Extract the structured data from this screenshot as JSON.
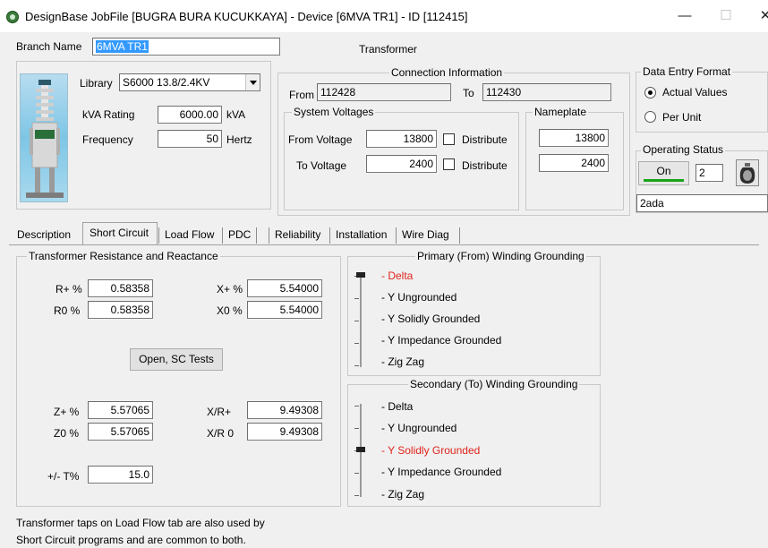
{
  "window": {
    "title": "DesignBase JobFile [BUGRA BURA KUCUKKAYA] - Device [6MVA TR1] - ID [112415]",
    "minimize_glyph": "—",
    "maximize_glyph": "☐",
    "close_glyph": "✕"
  },
  "header": {
    "branch_name_label": "Branch Name",
    "branch_name_value": "6MVA TR1",
    "device_type": "Transformer"
  },
  "library": {
    "label": "Library",
    "value": "S6000 13.8/2.4KV",
    "kva_label": "kVA Rating",
    "kva_value": "6000.00",
    "kva_unit": "kVA",
    "freq_label": "Frequency",
    "freq_value": "50",
    "freq_unit": "Hertz"
  },
  "connection": {
    "title": "Connection Information",
    "from_label": "From",
    "from_value": "112428",
    "to_label": "To",
    "to_value": "112430",
    "system_voltages_title": "System Voltages",
    "from_voltage_label": "From Voltage",
    "from_voltage_value": "13800",
    "to_voltage_label": "To Voltage",
    "to_voltage_value": "2400",
    "distribute_label": "Distribute",
    "nameplate_title": "Nameplate",
    "nameplate_from": "13800",
    "nameplate_to": "2400"
  },
  "data_entry": {
    "title": "Data Entry Format",
    "actual_values": "Actual Values",
    "per_unit": "Per Unit",
    "selected": "Actual Values"
  },
  "operating_status": {
    "title": "Operating Status",
    "on_label": "On",
    "count_value": "2",
    "note_value": "2ada"
  },
  "tabs": [
    "Description",
    "Short Circuit",
    "Load Flow",
    "PDC",
    "Reliability",
    "Installation",
    "Wire Diag"
  ],
  "active_tab": "Short Circuit",
  "resistance": {
    "title": "Transformer Resistance and Reactance",
    "r_pos_label": "R+ %",
    "r_pos_value": "0.58358",
    "x_pos_label": "X+ %",
    "x_pos_value": "5.54000",
    "r_zero_label": "R0 %",
    "r_zero_value": "0.58358",
    "x_zero_label": "X0 %",
    "x_zero_value": "5.54000",
    "open_sc_button": "Open, SC Tests",
    "z_pos_label": "Z+ %",
    "z_pos_value": "5.57065",
    "xr_pos_label": "X/R+",
    "xr_pos_value": "9.49308",
    "z_zero_label": "Z0 %",
    "z_zero_value": "5.57065",
    "xr_zero_label": "X/R 0",
    "xr_zero_value": "9.49308",
    "tap_label": "+/- T%",
    "tap_value": "15.0"
  },
  "primary_grounding": {
    "title": "Primary (From) Winding Grounding",
    "options": [
      "- Delta",
      "- Y Ungrounded",
      "- Y Solidly Grounded",
      "- Y Impedance Grounded",
      "- Zig Zag"
    ],
    "selected_index": 0
  },
  "secondary_grounding": {
    "title": "Secondary (To) Winding Grounding",
    "options": [
      "- Delta",
      "- Y Ungrounded",
      "- Y Solidly Grounded",
      "- Y Impedance Grounded",
      "- Zig Zag"
    ],
    "selected_index": 2
  },
  "footer_note": {
    "line1": "Transformer taps on Load Flow tab are also used by",
    "line2": "Short Circuit programs and are common to both."
  },
  "colors": {
    "selected_option": "#e0241b",
    "on_indicator": "#1aa31a",
    "selection_highlight": "#3399ff"
  }
}
